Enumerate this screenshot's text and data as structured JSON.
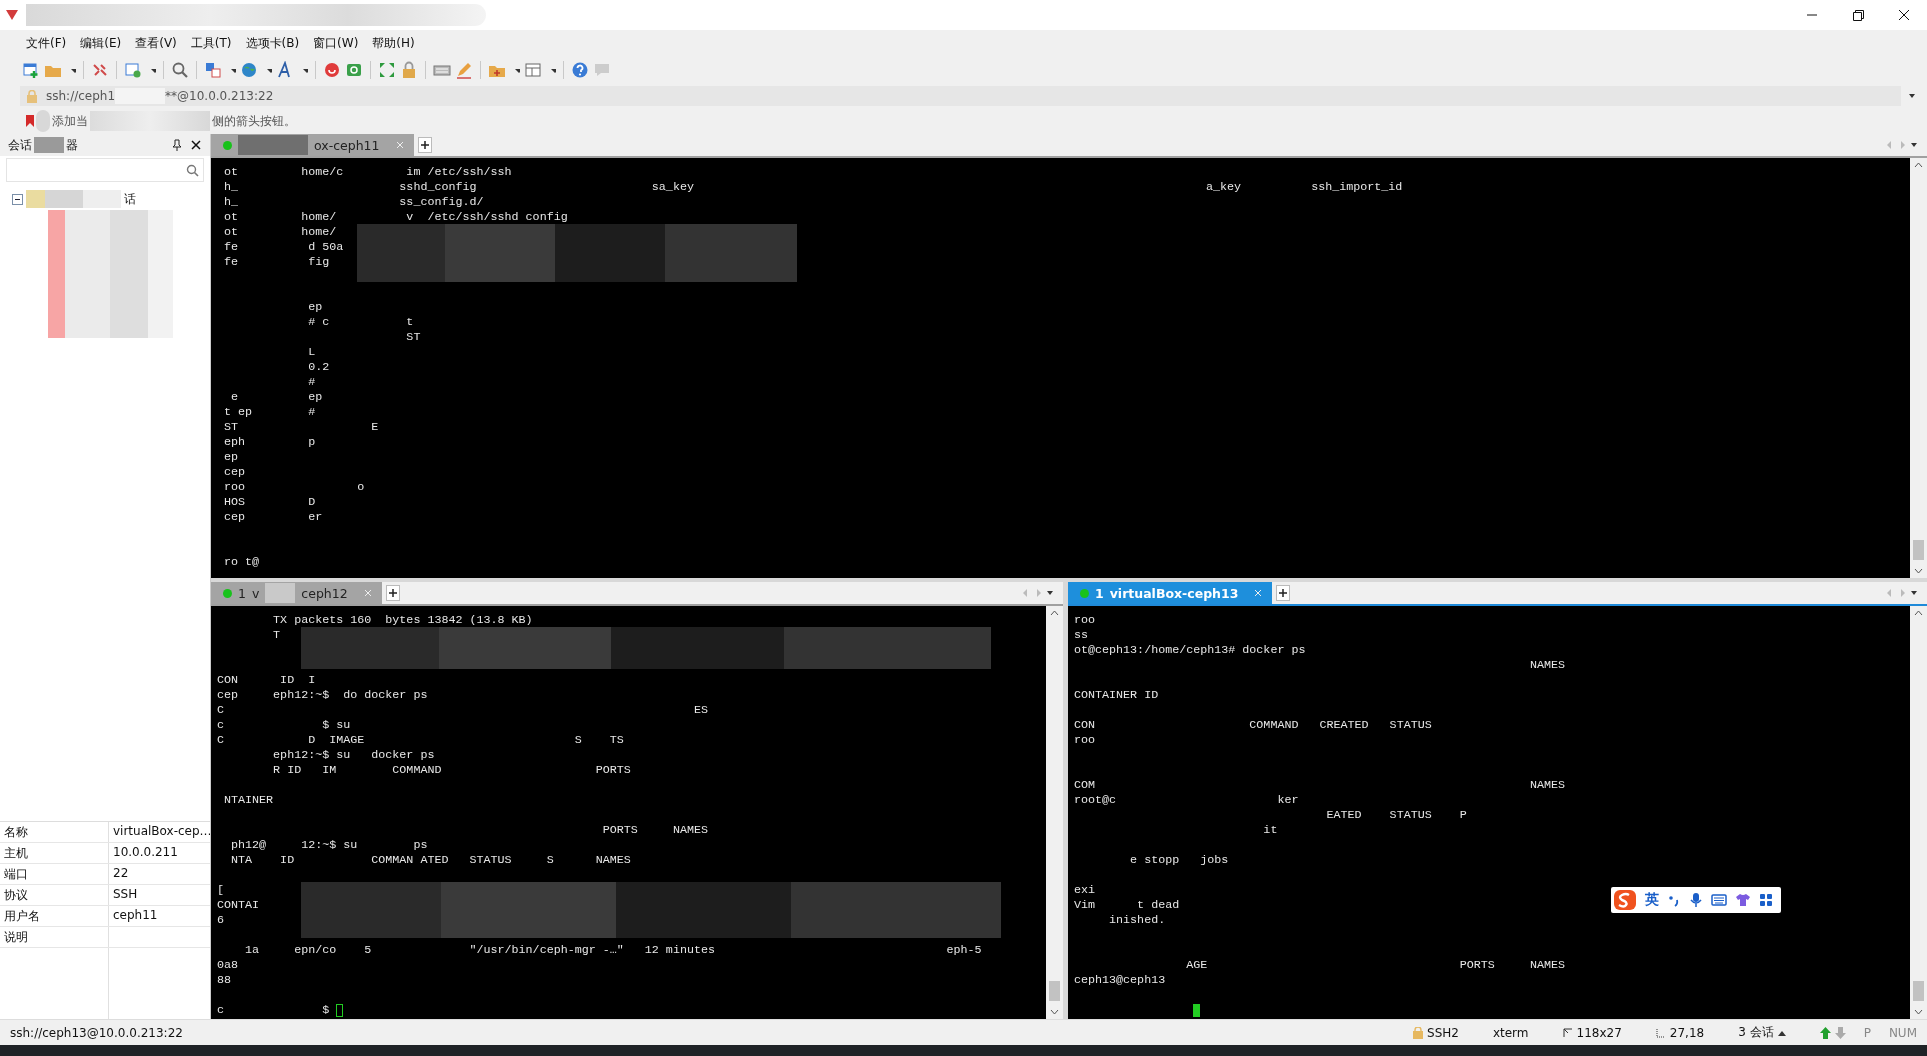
{
  "menu": [
    "文件(F)",
    "编辑(E)",
    "查看(V)",
    "工具(T)",
    "选项卡(B)",
    "窗口(W)",
    "帮助(H)"
  ],
  "address": {
    "parts": [
      "ssh://ceph1",
      "**@10.0.0.213:22"
    ]
  },
  "hint": {
    "parts": [
      "添加当",
      "侧的箭头按钮。"
    ]
  },
  "session_manager": {
    "title_parts": [
      "会话",
      "器"
    ],
    "tree": [
      {
        "label": "话",
        "expanded": true
      }
    ],
    "properties": [
      {
        "name": "名称",
        "value": "virtualBox-cep…"
      },
      {
        "name": "主机",
        "value": "10.0.0.211"
      },
      {
        "name": "端口",
        "value": "22"
      },
      {
        "name": "协议",
        "value": "SSH"
      },
      {
        "name": "用户名",
        "value": "ceph11"
      },
      {
        "name": "说明"
      }
    ]
  },
  "panes": [
    {
      "focused": false,
      "tabs": [
        {
          "label": "ox-ceph11",
          "selected": true,
          "connected": true
        }
      ],
      "lines": [
        {
          "kind": "text",
          "text": " ot         home/c         im /etc/ssh/ssh"
        },
        {
          "kind": "text",
          "text": " h_                       sshd_config                         sa_key                                                                         a_key          ssh_import_id"
        },
        {
          "kind": "text",
          "text": " h_                       ss_config.d/"
        },
        {
          "kind": "text",
          "text": " ot         home/          v  /etc/ssh/sshd config"
        },
        {
          "kind": "text",
          "text": " ot         home/"
        },
        {
          "kind": "text",
          "text": " fe          d 50a"
        },
        {
          "kind": "text",
          "text": " fe          fig"
        },
        {
          "kind": "blank"
        },
        {
          "kind": "blank"
        },
        {
          "kind": "text",
          "text": "             ep"
        },
        {
          "kind": "text",
          "text": "             # c           t"
        },
        {
          "kind": "text",
          "text": "                           ST"
        },
        {
          "kind": "text",
          "text": "             L"
        },
        {
          "kind": "text",
          "text": "             0.2"
        },
        {
          "kind": "text",
          "text": "             #"
        },
        {
          "kind": "text",
          "text": "  e          ep"
        },
        {
          "kind": "text",
          "text": " t ep        #"
        },
        {
          "kind": "text",
          "text": " ST                   E"
        },
        {
          "kind": "text",
          "text": " eph         p"
        },
        {
          "kind": "text",
          "text": " ep"
        },
        {
          "kind": "text",
          "text": " cep"
        },
        {
          "kind": "text",
          "text": " roo                o"
        },
        {
          "kind": "text",
          "text": " HOS         D"
        },
        {
          "kind": "text",
          "text": " cep         er"
        },
        {
          "kind": "blank"
        },
        {
          "kind": "blank"
        },
        {
          "kind": "text",
          "text": " ro t@"
        }
      ]
    },
    {
      "focused": false,
      "tabs": [
        {
          "number": "1",
          "label": "v",
          "label_end": "ceph12",
          "selected": true,
          "connected": true
        }
      ],
      "lines": [
        {
          "kind": "text",
          "text": "        TX packets 160  bytes 13842 (13.8 KB)"
        },
        {
          "kind": "text",
          "text": "        T"
        },
        {
          "kind": "blank"
        },
        {
          "kind": "blank"
        },
        {
          "kind": "text",
          "text": "CON      ID  I"
        },
        {
          "kind": "text",
          "text": "cep     eph12:~$  do docker ps"
        },
        {
          "kind": "text",
          "text": "C                                                                   ES"
        },
        {
          "kind": "text",
          "text": "c              $ su"
        },
        {
          "kind": "text",
          "text": "C            D  IMAGE                              S    TS"
        },
        {
          "kind": "text",
          "text": "        eph12:~$ su   docker ps"
        },
        {
          "kind": "text",
          "text": "        R ID   IM        COMMAND                      PORTS"
        },
        {
          "kind": "blank"
        },
        {
          "kind": "text",
          "text": " NTAINER"
        },
        {
          "kind": "blank"
        },
        {
          "kind": "text",
          "text": "                                                       PORTS     NAMES"
        },
        {
          "kind": "text",
          "text": "  ph12@     12:~$ su        ps"
        },
        {
          "kind": "text",
          "text": "  NTA    ID           COMMAN ATED   STATUS     S      NAMES"
        },
        {
          "kind": "blank"
        },
        {
          "kind": "text",
          "text": "["
        },
        {
          "kind": "text",
          "text": "CONTAI"
        },
        {
          "kind": "text",
          "text": "6"
        },
        {
          "kind": "blank"
        },
        {
          "kind": "text",
          "text": "    1a     epn/co    5              \"/usr/bin/ceph-mgr -…\"   12 minutes                                 eph-5"
        },
        {
          "kind": "text",
          "text": "0a8"
        },
        {
          "kind": "text",
          "text": "88"
        },
        {
          "kind": "blank"
        },
        {
          "kind": "text",
          "text": "c              $ ",
          "cursor": true
        }
      ]
    },
    {
      "focused": true,
      "tabs": [
        {
          "number": "1",
          "label": "virtualBox-ceph13",
          "selected": true,
          "connected": true
        }
      ],
      "lines": [
        {
          "kind": "text",
          "text": "roo"
        },
        {
          "kind": "text",
          "text": "ss"
        },
        {
          "kind": "text",
          "text": "ot@ceph13:/home/ceph13# docker ps"
        },
        {
          "kind": "text",
          "text": "                                                                 NAMES"
        },
        {
          "kind": "blank"
        },
        {
          "kind": "text",
          "text": "CONTAINER ID"
        },
        {
          "kind": "blank"
        },
        {
          "kind": "text",
          "text": "CON                      COMMAND   CREATED   STATUS"
        },
        {
          "kind": "text",
          "text": "roo"
        },
        {
          "kind": "blank"
        },
        {
          "kind": "blank"
        },
        {
          "kind": "text",
          "text": "COM                                                              NAMES"
        },
        {
          "kind": "text",
          "text": "root@c                       ker"
        },
        {
          "kind": "text",
          "text": "                                    EATED    STATUS    P"
        },
        {
          "kind": "text",
          "text": "                           it"
        },
        {
          "kind": "blank"
        },
        {
          "kind": "text",
          "text": "        e stopp   jobs"
        },
        {
          "kind": "blank"
        },
        {
          "kind": "text",
          "text": "exi"
        },
        {
          "kind": "text",
          "text": "Vim      t dead"
        },
        {
          "kind": "text",
          "text": "     inished."
        },
        {
          "kind": "blank"
        },
        {
          "kind": "blank"
        },
        {
          "kind": "text",
          "text": "                AGE                                    PORTS     NAMES"
        },
        {
          "kind": "text",
          "text": "ceph13@ceph13"
        },
        {
          "kind": "blank"
        },
        {
          "kind": "blank",
          "cursor": true
        }
      ]
    }
  ],
  "ime": {
    "label": "英"
  },
  "status_bar": {
    "left": "ssh://ceph13@10.0.0.213:22",
    "items": [
      {
        "kind": "lock",
        "text": "SSH2"
      },
      {
        "kind": "plain",
        "text": "xterm"
      },
      {
        "kind": "size",
        "text": "118x27"
      },
      {
        "kind": "position",
        "text": "27,18"
      },
      {
        "kind": "sessions",
        "text": "3 会话"
      },
      {
        "kind": "arrows"
      },
      {
        "kind": "dim",
        "text": "P"
      },
      {
        "kind": "dim",
        "text": "NUM"
      }
    ]
  }
}
